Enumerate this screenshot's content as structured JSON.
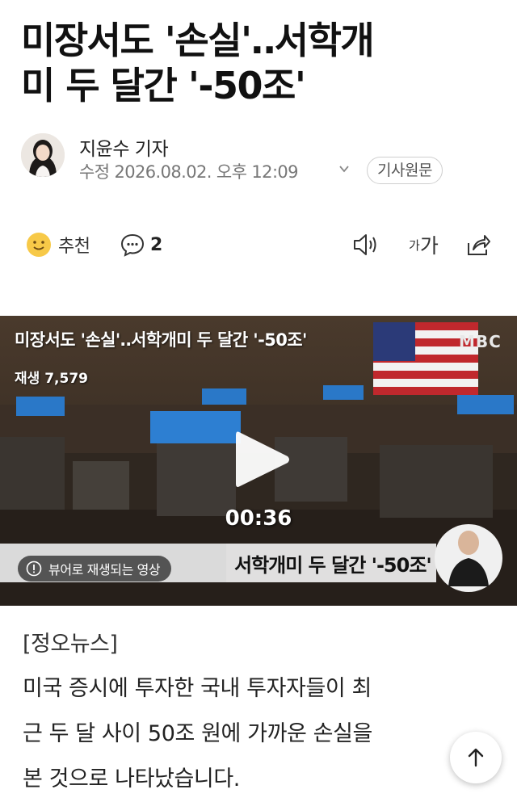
{
  "article": {
    "headline_line1": "미장서도 '손실'‥서학개",
    "headline_line2": "미 두 달간 '-50조'",
    "reporter": "지윤수 기자",
    "date_text": "수정 2026.08.02. 오후 12:09",
    "original_label": "기사원문"
  },
  "actions": {
    "recommend_label": "추천",
    "comment_count": "2",
    "font_size_label_small": "가",
    "font_size_label_large": "가"
  },
  "video": {
    "title": "미장서도 '손실'‥서학개미 두 달간 '-50조'",
    "views": "재생 7,579",
    "duration": "00:36",
    "caption": "서학개미 두 달간 '-50조'",
    "notice": "뷰어로 재생되는 영상",
    "logo": "MBC"
  },
  "body": {
    "agency": "[정오뉴스]",
    "para_line1": "미국 증시에 투자한 국내 투자자들이 최",
    "para_line2": "근 두 달 사이 50조 원에 가까운 손실을",
    "para_line3": "본 것으로 나타났습니다."
  },
  "icons": {
    "recommend": "smile-face-icon",
    "comment": "comment-bubble-icon",
    "tts": "speaker-icon",
    "font": "font-size-icon",
    "share": "share-icon",
    "scroll_top": "arrow-up-icon"
  },
  "colors": {
    "accent_yellow": "#f7c948",
    "text_dark": "#111111",
    "text_gray": "#777777"
  }
}
